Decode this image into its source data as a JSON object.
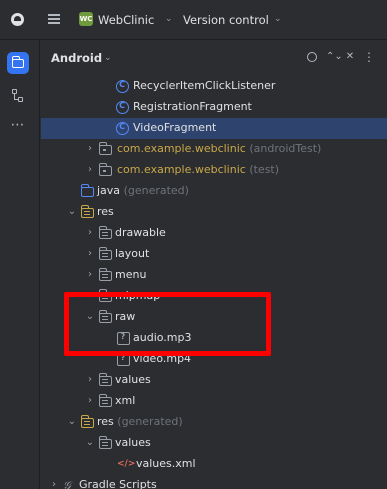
{
  "titlebar": {
    "project_badge": "WC",
    "project_name": "WebClinic",
    "vcs_label": "Version control"
  },
  "icons": {
    "app_logo": "android-studio-logo-icon",
    "main_menu": "hamburger-menu-icon",
    "project_tool": "folder-icon",
    "structure_tool": "structure-icon",
    "more_tools": "more-horizontal-icon",
    "locate": "target-icon",
    "expand_all": "expand-icon",
    "collapse_all": "collapse-icon",
    "options": "more-vertical-icon"
  },
  "panel": {
    "title": "Android",
    "more_glyph": "⋯",
    "options_glyph": "⋮"
  },
  "tree": {
    "recycler_listener": "RecyclerItemClickListener",
    "registration_fragment": "RegistrationFragment",
    "video_fragment": "VideoFragment",
    "pkg_android_test": "com.example.webclinic",
    "pkg_android_test_hint": "(androidTest)",
    "pkg_test": "com.example.webclinic",
    "pkg_test_hint": "(test)",
    "java_generated": "java",
    "java_generated_hint": "(generated)",
    "res": "res",
    "drawable": "drawable",
    "layout": "layout",
    "menu": "menu",
    "mipmap": "mipmap",
    "raw": "raw",
    "audio_file": "audio.mp3",
    "video_file": "video.mp4",
    "values": "values",
    "xml": "xml",
    "res_generated": "res",
    "res_generated_hint": "(generated)",
    "values_generated": "values",
    "values_xml": "values.xml",
    "gradle_scripts": "Gradle Scripts"
  },
  "colors": {
    "background": "#2b2d30",
    "selection": "#2e436e",
    "accent": "#3574f0",
    "highlight_border": "#ff0000",
    "class_icon": "#548af7",
    "resource_folder": "#c9a84a"
  }
}
